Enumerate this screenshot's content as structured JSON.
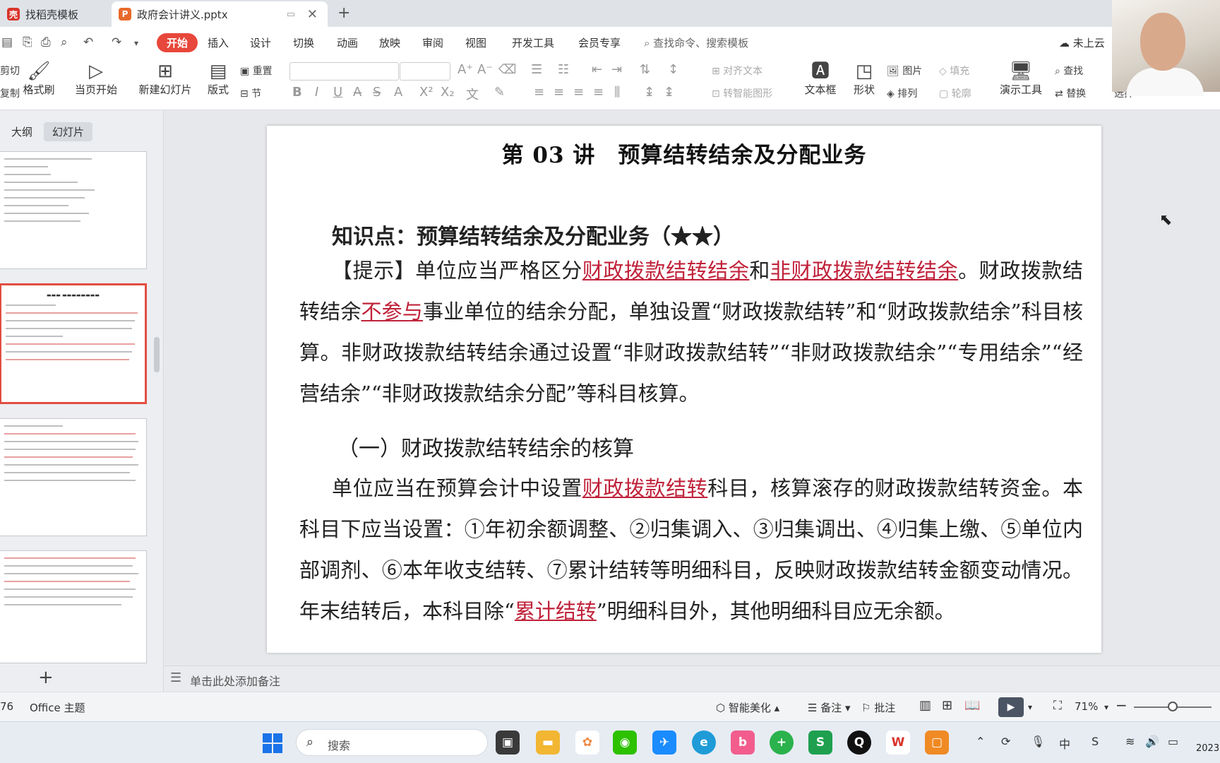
{
  "tabs": [
    {
      "label": "找稻壳模板",
      "icon": "docer-icon"
    },
    {
      "label": "政府会计讲义.pptx",
      "icon": "ppt-icon"
    }
  ],
  "menu": [
    "开始",
    "插入",
    "设计",
    "切换",
    "动画",
    "放映",
    "审阅",
    "视图",
    "开发工具",
    "会员专享"
  ],
  "search_placeholder": "查找命令、搜索模板",
  "cloud_status": "未上云",
  "ribbon": {
    "cut": "剪切",
    "copy": "复制",
    "format_painter": "格式刷",
    "from_current": "当页开始",
    "new_slide": "新建幻灯片",
    "layout": "版式",
    "reset": "重置",
    "section": "节",
    "align_text": "对齐文本",
    "smart_shape": "转智能图形",
    "textbox": "文本框",
    "shape": "形状",
    "picture": "图片",
    "arrange": "排列",
    "fill": "填充",
    "outline": "轮廓",
    "present_tools": "演示工具",
    "find": "查找",
    "replace": "替换",
    "select": "选择"
  },
  "left_panel": {
    "outline_tab": "大纲",
    "slides_tab": "幻灯片"
  },
  "slide": {
    "title": "第 03 讲　预算结转结余及分配业务",
    "knowledge_point": "知识点：预算结转结余及分配业务（★★）",
    "p1_a": "【提示】单位应当严格区分",
    "p1_h1": "财政拨款结转结余",
    "p1_b": "和",
    "p1_h2": "非财政拨款结转结余",
    "p1_c": "。财政拨款结转结余",
    "p1_h3": "不参与",
    "p1_d": "事业单位的结余分配，单独设置“财政拨款结转”和“财政拨款结余”科目核算。非财政拨款结转结余通过设置“非财政拨款结转”“非财政拨款结余”“专用结余”“经营结余”“非财政拨款结余分配”等科目核算。",
    "subheading": "（一）财政拨款结转结余的核算",
    "p2_a": "单位应当在预算会计中设置",
    "p2_h1": "财政拨款结转",
    "p2_b": "科目，核算滚存的财政拨款结转资金。本科目下应当设置：①年初余额调整、②归集调入、③归集调出、④归集上缴、⑤单位内部调剂、⑥本年收支结转、⑦累计结转等明细科目，反映财政拨款结转金额变动情况。年末结转后，本科目除“",
    "p2_h2": "累计结转",
    "p2_c": "”明细科目外，其他明细科目应无余额。"
  },
  "notes_placeholder": "单击此处添加备注",
  "status": {
    "slide_num": "76",
    "theme": "Office 主题",
    "beautify": "智能美化",
    "notes": "备注",
    "comment": "批注",
    "zoom": "71%"
  },
  "taskbar": {
    "search": "搜索",
    "year": "2023"
  }
}
